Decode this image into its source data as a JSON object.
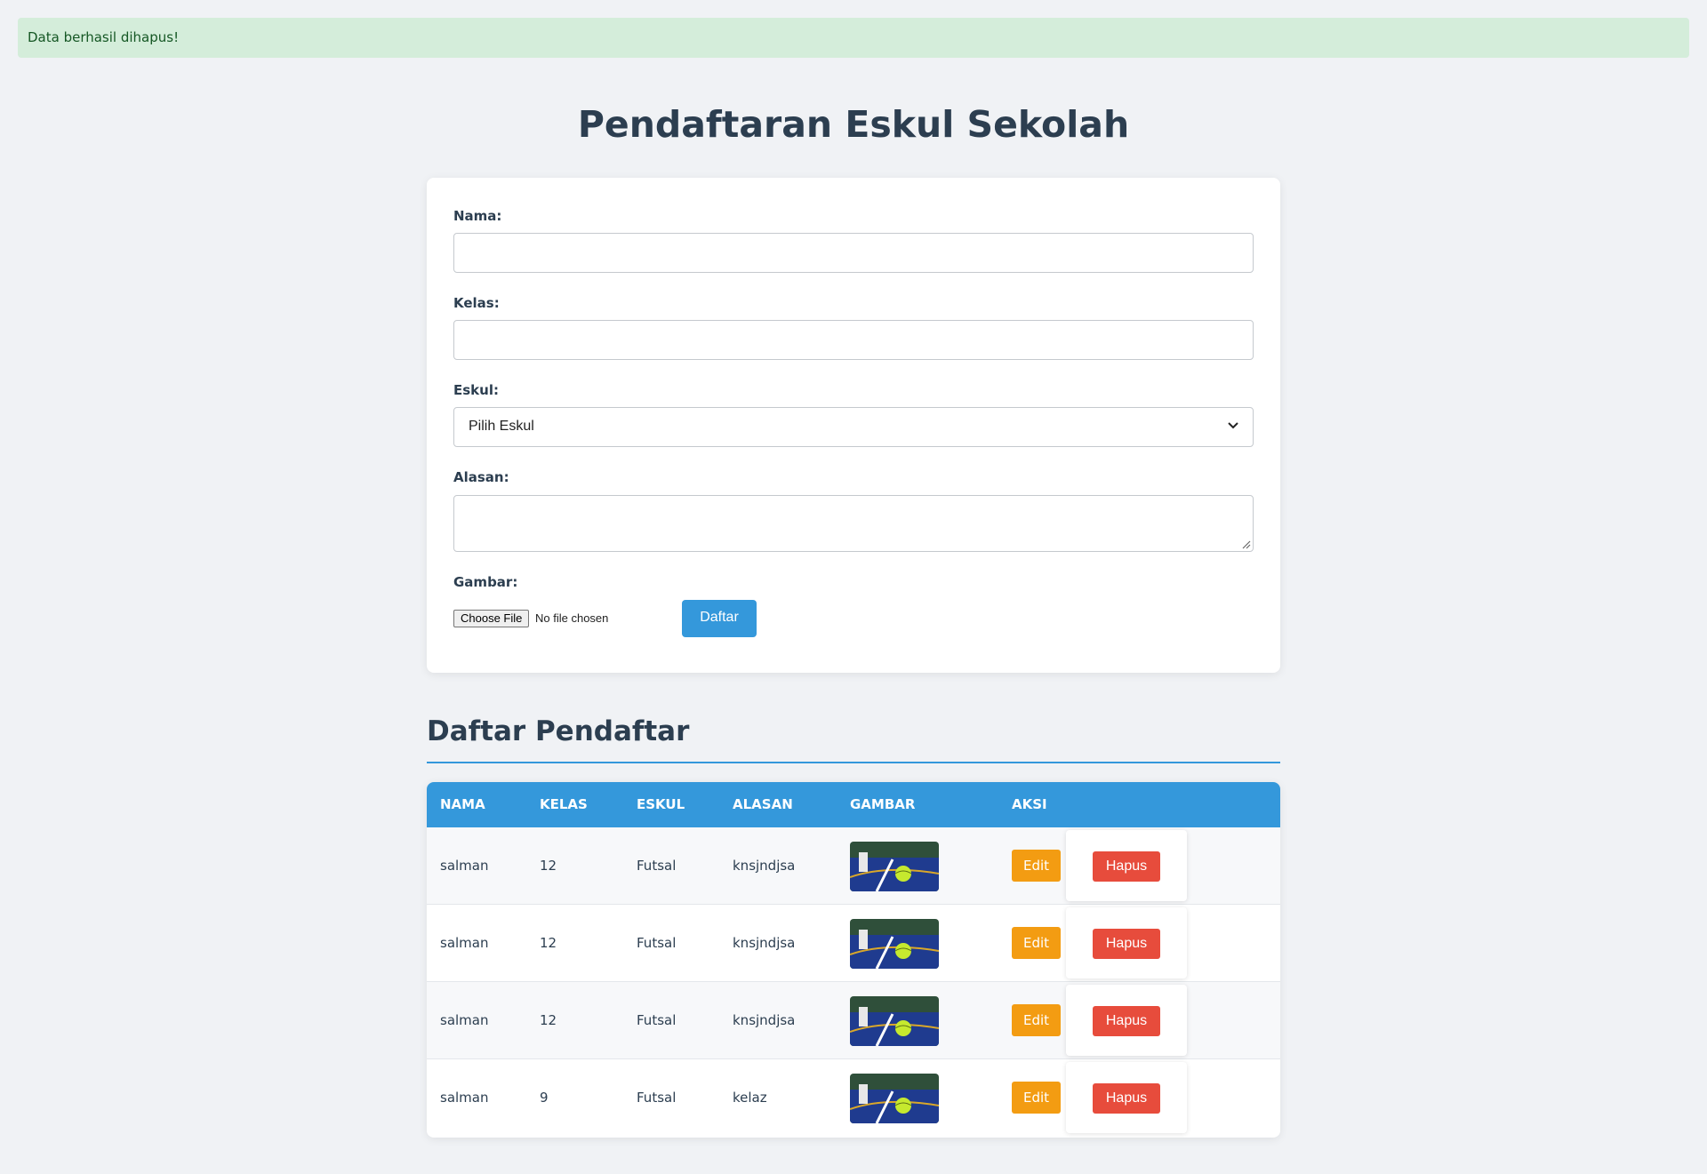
{
  "alert": {
    "message": "Data berhasil dihapus!",
    "color": "#d4edda"
  },
  "page": {
    "title": "Pendaftaran Eskul Sekolah"
  },
  "form": {
    "nama_label": "Nama:",
    "nama_value": "",
    "kelas_label": "Kelas:",
    "kelas_value": "",
    "eskul_label": "Eskul:",
    "eskul_selected": "Pilih Eskul",
    "alasan_label": "Alasan:",
    "alasan_value": "",
    "gambar_label": "Gambar:",
    "file_button": "Choose File",
    "file_status": "No file chosen",
    "submit_label": "Daftar"
  },
  "list": {
    "title": "Daftar Pendaftar",
    "columns": [
      "Nama",
      "Kelas",
      "Eskul",
      "Alasan",
      "Gambar",
      "Aksi"
    ],
    "rows": [
      {
        "nama": "salman",
        "kelas": "12",
        "eskul": "Futsal",
        "alasan": "knsjndjsa",
        "edit": "Edit",
        "hapus": "Hapus"
      },
      {
        "nama": "salman",
        "kelas": "12",
        "eskul": "Futsal",
        "alasan": "knsjndjsa",
        "edit": "Edit",
        "hapus": "Hapus"
      },
      {
        "nama": "salman",
        "kelas": "12",
        "eskul": "Futsal",
        "alasan": "knsjndjsa",
        "edit": "Edit",
        "hapus": "Hapus"
      },
      {
        "nama": "salman",
        "kelas": "9",
        "eskul": "Futsal",
        "alasan": "kelaz",
        "edit": "Edit",
        "hapus": "Hapus"
      }
    ]
  },
  "colors": {
    "primary": "#3498db",
    "edit": "#f39c12",
    "delete": "#e74c3c",
    "heading": "#2c3e50"
  }
}
